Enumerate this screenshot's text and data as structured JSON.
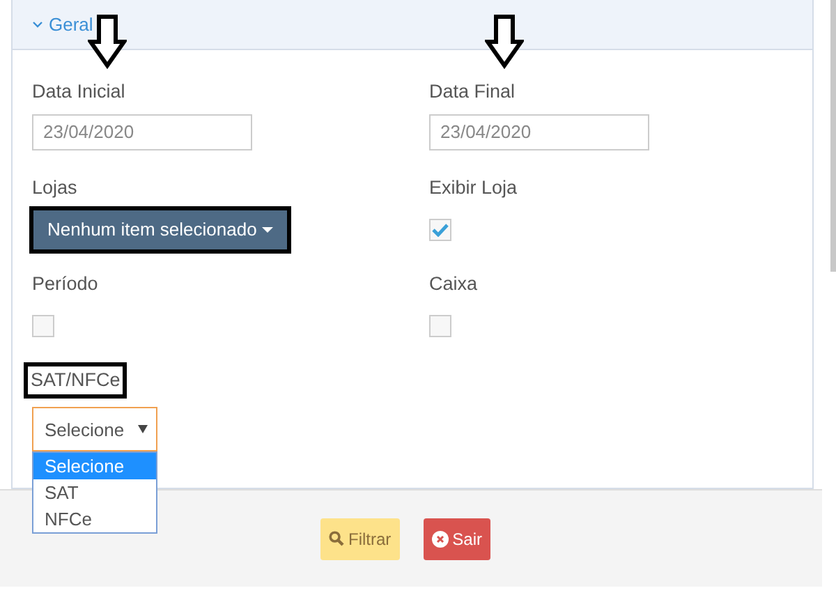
{
  "panel": {
    "title": "Geral",
    "expanded": true
  },
  "fields": [
    {
      "kind": "date",
      "label": "Data Inicial",
      "value": "23/04/2020",
      "arrow": true,
      "highlighted": false
    },
    {
      "kind": "date",
      "label": "Data Final",
      "value": "23/04/2020",
      "arrow": true,
      "highlighted": false
    },
    {
      "kind": "multiselect",
      "label": "Lojas",
      "value": "Nenhum item selecionado",
      "arrow": false,
      "highlighted": true
    },
    {
      "kind": "checkbox",
      "label": "Exibir Loja",
      "checked": true,
      "arrow": false,
      "highlighted": false
    },
    {
      "kind": "checkbox",
      "label": "Período",
      "checked": false,
      "arrow": false,
      "highlighted": false
    },
    {
      "kind": "checkbox",
      "label": "Caixa",
      "checked": false,
      "arrow": false,
      "highlighted": false
    },
    {
      "kind": "select",
      "label": "SAT/NFCe",
      "value": "Selecione",
      "arrow": false,
      "highlighted": true,
      "expanded": true,
      "options": [
        {
          "label": "Selecione",
          "selected": true
        },
        {
          "label": "SAT",
          "selected": false
        },
        {
          "label": "NFCe",
          "selected": false
        }
      ]
    }
  ],
  "buttons": [
    {
      "kind": "filter",
      "label": "Filtrar"
    },
    {
      "kind": "exit",
      "label": "Sair"
    }
  ]
}
